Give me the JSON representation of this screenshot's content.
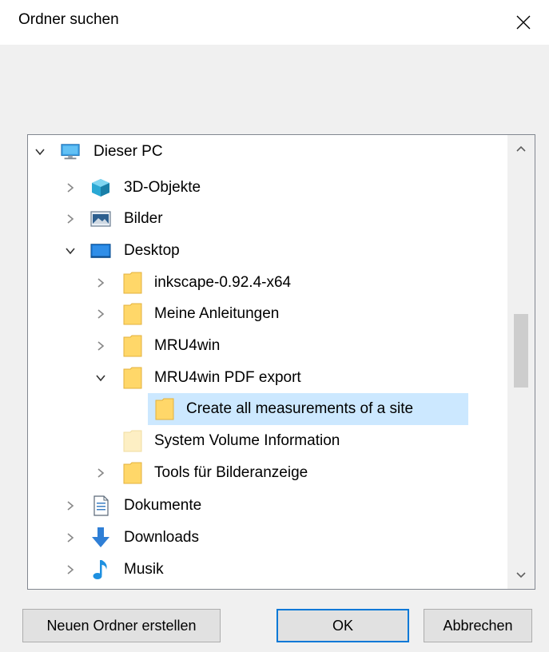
{
  "dialog": {
    "title": "Ordner suchen",
    "close_icon": "close-icon"
  },
  "tree": {
    "items": [
      {
        "label": "Dieser PC",
        "icon": "computer-icon",
        "expanded": true
      },
      {
        "label": "3D-Objekte",
        "icon": "3d-objects-icon",
        "expanded": false
      },
      {
        "label": "Bilder",
        "icon": "pictures-icon",
        "expanded": false
      },
      {
        "label": "Desktop",
        "icon": "desktop-icon",
        "expanded": true
      },
      {
        "label": "inkscape-0.92.4-x64",
        "icon": "folder-icon",
        "expanded": false
      },
      {
        "label": "Meine Anleitungen",
        "icon": "folder-icon",
        "expanded": false
      },
      {
        "label": "MRU4win",
        "icon": "folder-icon",
        "expanded": false
      },
      {
        "label": "MRU4win PDF export",
        "icon": "folder-icon",
        "expanded": true
      },
      {
        "label": "Create all measurements of a site",
        "icon": "folder-icon",
        "selected": true
      },
      {
        "label": "System Volume Information",
        "icon": "hidden-folder-icon"
      },
      {
        "label": "Tools für Bilderanzeige",
        "icon": "folder-icon",
        "expanded": false
      },
      {
        "label": "Dokumente",
        "icon": "documents-icon",
        "expanded": false
      },
      {
        "label": "Downloads",
        "icon": "downloads-icon",
        "expanded": false
      },
      {
        "label": "Musik",
        "icon": "music-icon",
        "expanded": false
      }
    ]
  },
  "buttons": {
    "new_folder": "Neuen Ordner erstellen",
    "ok": "OK",
    "cancel": "Abbrechen"
  },
  "colors": {
    "selection": "#cce8ff",
    "folder": "#ffd769",
    "accent": "#0078d7"
  }
}
